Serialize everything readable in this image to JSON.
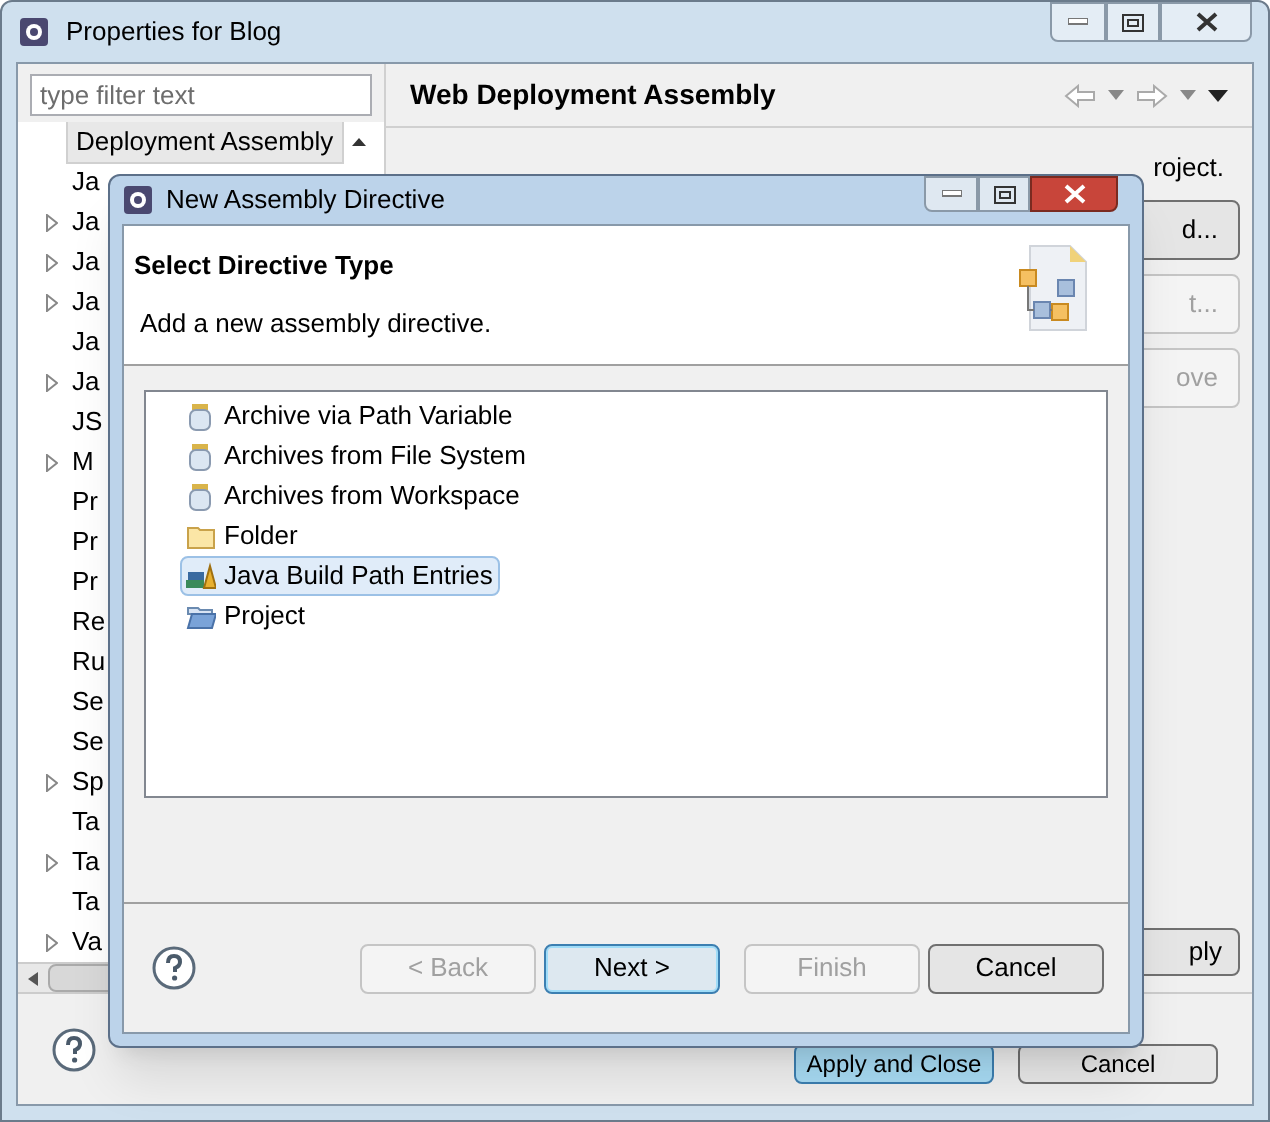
{
  "window": {
    "title": "Properties for Blog"
  },
  "filter": {
    "placeholder": "type filter text"
  },
  "tree": [
    {
      "label": "Deployment Assembly",
      "expandable": false,
      "selected": true
    },
    {
      "label": "Ja",
      "expandable": false,
      "selected": false
    },
    {
      "label": "Ja",
      "expandable": true,
      "selected": false
    },
    {
      "label": "Ja",
      "expandable": true,
      "selected": false
    },
    {
      "label": "Ja",
      "expandable": true,
      "selected": false
    },
    {
      "label": "Ja",
      "expandable": false,
      "selected": false
    },
    {
      "label": "Ja",
      "expandable": true,
      "selected": false
    },
    {
      "label": "JS",
      "expandable": false,
      "selected": false
    },
    {
      "label": "M",
      "expandable": true,
      "selected": false
    },
    {
      "label": "Pr",
      "expandable": false,
      "selected": false
    },
    {
      "label": "Pr",
      "expandable": false,
      "selected": false
    },
    {
      "label": "Pr",
      "expandable": false,
      "selected": false
    },
    {
      "label": "Re",
      "expandable": false,
      "selected": false
    },
    {
      "label": "Ru",
      "expandable": false,
      "selected": false
    },
    {
      "label": "Se",
      "expandable": false,
      "selected": false
    },
    {
      "label": "Se",
      "expandable": false,
      "selected": false
    },
    {
      "label": "Sp",
      "expandable": true,
      "selected": false
    },
    {
      "label": "Ta",
      "expandable": false,
      "selected": false
    },
    {
      "label": "Ta",
      "expandable": true,
      "selected": false
    },
    {
      "label": "Ta",
      "expandable": false,
      "selected": false
    },
    {
      "label": "Va",
      "expandable": true,
      "selected": false
    }
  ],
  "page": {
    "title": "Web Deployment Assembly",
    "description": "roject.",
    "side_buttons": [
      {
        "label": "d...",
        "disabled": false
      },
      {
        "label": "t...",
        "disabled": true
      },
      {
        "label": "ove",
        "disabled": true
      }
    ],
    "apply": "ply"
  },
  "bottom_buttons": [
    {
      "label": "Apply and Close",
      "default": true
    },
    {
      "label": "Cancel",
      "default": false
    }
  ],
  "dialog": {
    "title": "New Assembly Directive",
    "heading": "Select Directive Type",
    "description": "Add a new assembly directive.",
    "items": [
      {
        "label": "Archive via Path Variable",
        "kind": "jar",
        "selected": false
      },
      {
        "label": "Archives from File System",
        "kind": "jar",
        "selected": false
      },
      {
        "label": "Archives from Workspace",
        "kind": "jar",
        "selected": false
      },
      {
        "label": "Folder",
        "kind": "folder",
        "selected": false
      },
      {
        "label": "Java Build Path Entries",
        "kind": "library",
        "selected": true
      },
      {
        "label": "Project",
        "kind": "project",
        "selected": false
      }
    ],
    "buttons": [
      {
        "label": "< Back",
        "disabled": true,
        "default": false
      },
      {
        "label": "Next >",
        "disabled": false,
        "default": true
      },
      {
        "label": "Finish",
        "disabled": true,
        "default": false
      },
      {
        "label": "Cancel",
        "disabled": false,
        "default": false
      }
    ]
  }
}
